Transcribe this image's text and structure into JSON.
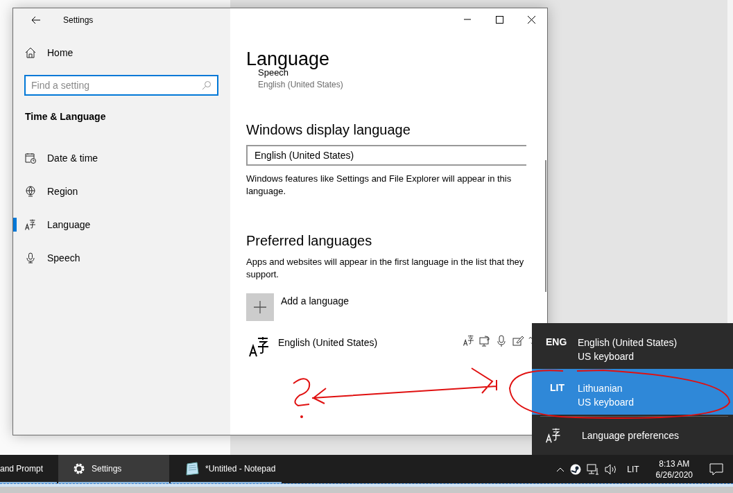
{
  "settings_window": {
    "title": "Settings",
    "sidebar": {
      "home": "Home",
      "search": {
        "placeholder": "Find a setting"
      },
      "section": "Time & Language",
      "items": [
        {
          "kind": "date-time",
          "label": "Date & time",
          "selected": false
        },
        {
          "kind": "region",
          "label": "Region",
          "selected": false
        },
        {
          "kind": "language",
          "label": "Language",
          "selected": true
        },
        {
          "kind": "speech",
          "label": "Speech",
          "selected": false
        }
      ]
    },
    "content": {
      "title": "Language",
      "speech": {
        "label": "Speech",
        "value": "English (United States)"
      },
      "display_language": {
        "heading": "Windows display language",
        "value": "English (United States)",
        "description": "Windows features like Settings and File Explorer will appear in this language."
      },
      "preferred_languages": {
        "heading": "Preferred languages",
        "description": "Apps and websites will appear in the first language in the list that they support.",
        "add_label": "Add a language",
        "languages": [
          {
            "name": "English (United States)"
          }
        ]
      }
    }
  },
  "language_flyout": {
    "items": [
      {
        "code": "ENG",
        "name": "English (United States)",
        "keyboard": "US keyboard",
        "selected": false
      },
      {
        "code": "LIT",
        "name": "Lithuanian",
        "keyboard": "US keyboard",
        "selected": true
      }
    ],
    "preferences": "Language preferences"
  },
  "taskbar": {
    "apps": [
      {
        "kind": "cmd",
        "label": "and Prompt",
        "selected": false
      },
      {
        "kind": "settings",
        "label": "Settings",
        "selected": true
      },
      {
        "kind": "notepad",
        "label": "*Untitled - Notepad",
        "selected": false
      }
    ],
    "tray": {
      "input_indicator": "LIT",
      "time": "8:13 AM",
      "date": "6/26/2020"
    }
  }
}
